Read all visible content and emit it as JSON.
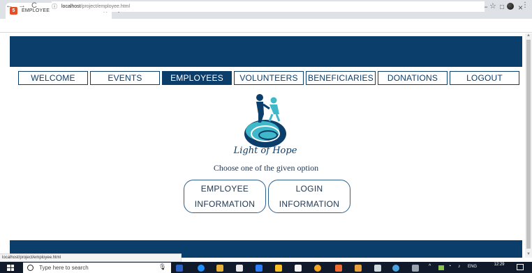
{
  "browser": {
    "tab_title": "EMPLOYEE",
    "tab_close": "×",
    "new_tab": "+",
    "window_minimize": "–",
    "window_maximize": "□",
    "window_close": "×",
    "back": "←",
    "forward": "→",
    "reload": "C",
    "url_host": "localhost",
    "url_path": "/project/employee.html",
    "star": "☆",
    "menu": "⋮",
    "status_url": "localhost/project/employee.html"
  },
  "nav": {
    "items": [
      {
        "label": "WELCOME"
      },
      {
        "label": "EVENTS"
      },
      {
        "label": "EMPLOYEES"
      },
      {
        "label": "VOLUNTEERS"
      },
      {
        "label": "BENEFICIARIES"
      },
      {
        "label": "DONATIONS"
      },
      {
        "label": "LOGOUT"
      }
    ],
    "active_index": 2
  },
  "logo": {
    "text": "Light of Hope"
  },
  "main": {
    "prompt": "Choose one of the given option",
    "option_employee_line1": "EMPLOYEE",
    "option_employee_line2": "INFORMATION",
    "option_login_line1": "LOGIN",
    "option_login_line2": "INFORMATION"
  },
  "taskbar": {
    "search_placeholder": "Type here to search",
    "tray_lang": "ENG",
    "clock_time": "12:29"
  },
  "colors": {
    "brand_navy": "#0c3e6b",
    "logo_teal": "#3fb8c9",
    "taskbar": "#101a2b"
  }
}
